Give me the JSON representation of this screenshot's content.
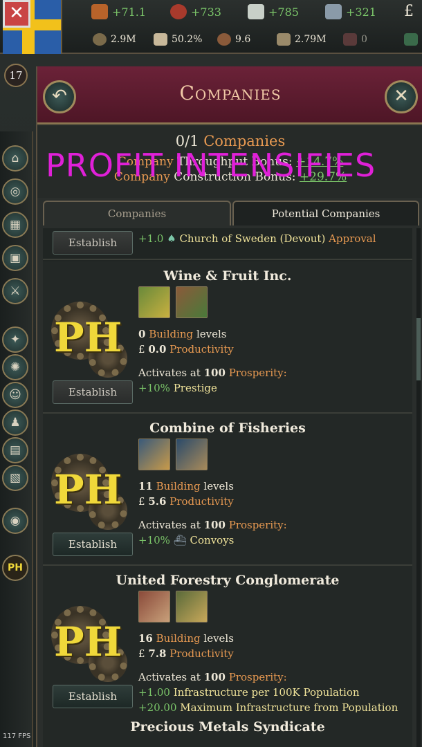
{
  "topbar": {
    "stats": [
      {
        "icon": "authority-icon",
        "value": "+71.1"
      },
      {
        "icon": "influence-icon",
        "value": "+733"
      },
      {
        "icon": "dove-icon",
        "value": "+785"
      },
      {
        "icon": "ship-icon",
        "value": "+321"
      },
      {
        "icon": "pound-icon",
        "value": "£"
      }
    ],
    "sub": [
      {
        "icon": "gdp-icon",
        "value": "2.9M"
      },
      {
        "icon": "literacy-icon",
        "value": "50.2%"
      },
      {
        "icon": "sol-icon",
        "value": "9.6"
      },
      {
        "icon": "population-icon",
        "value": "2.79M"
      },
      {
        "icon": "fist-icon",
        "value": "0"
      }
    ],
    "rank": "17"
  },
  "header": {
    "title": "Companies"
  },
  "summary": {
    "count": "0/1",
    "count_label": "Companies",
    "throughput_label": "Company",
    "throughput_text": "Throughput Bonus:",
    "throughput_value": "+14.7%",
    "construction_label": "Company",
    "construction_text": "Construction Bonus:",
    "construction_value": "+29.7%"
  },
  "overlay_text": "PROFIT INTENSIFIES",
  "tabs": {
    "tab1": "Companies",
    "tab2": "Potential Companies"
  },
  "row0": {
    "button": "Establish",
    "value": "+1.0",
    "text": "Church of Sweden (Devout)",
    "suffix": "Approval"
  },
  "cards": [
    {
      "title": "Wine & Fruit Inc.",
      "levels": "0",
      "levels_label": "Building",
      "levels_suffix": "levels",
      "prod": "0.0",
      "prod_label": "Productivity",
      "activates": "Activates at",
      "threshold": "100",
      "prosperity": "Prosperity:",
      "bonus1_value": "+10%",
      "bonus1_text": "Prestige",
      "button": "Establish"
    },
    {
      "title": "Combine of Fisheries",
      "levels": "11",
      "levels_label": "Building",
      "levels_suffix": "levels",
      "prod": "5.6",
      "prod_label": "Productivity",
      "activates": "Activates at",
      "threshold": "100",
      "prosperity": "Prosperity:",
      "bonus1_value": "+10%",
      "bonus1_text": "Convoys",
      "button": "Establish"
    },
    {
      "title": "United Forestry Conglomerate",
      "levels": "16",
      "levels_label": "Building",
      "levels_suffix": "levels",
      "prod": "7.8",
      "prod_label": "Productivity",
      "activates": "Activates at",
      "threshold": "100",
      "prosperity": "Prosperity:",
      "bonus1_value": "+1.00",
      "bonus1_text": "Infrastructure per 100K Population",
      "bonus2_value": "+20.00",
      "bonus2_text": "Maximum Infrastructure from Population",
      "button": "Establish"
    }
  ],
  "last_title": "Precious Metals Syndicate",
  "fps": "117 FPS"
}
